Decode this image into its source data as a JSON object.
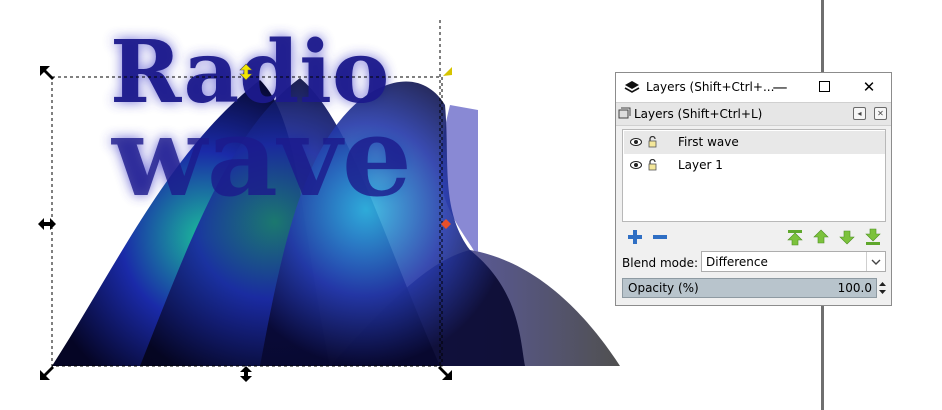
{
  "canvas": {
    "artwork_words": [
      "Radio",
      "wave"
    ]
  },
  "layers_window": {
    "title": "Layers (Shift+Ctrl+...",
    "minimize_glyph": "—",
    "close_glyph": "✕",
    "dock_title": "Layers (Shift+Ctrl+L)",
    "layers": [
      {
        "label": "First wave",
        "selected": true
      },
      {
        "label": "Layer 1",
        "selected": false
      }
    ],
    "blend_mode_label": "Blend mode:",
    "blend_mode_value": "Difference",
    "opacity_label": "Opacity (%)",
    "opacity_value": "100.0"
  },
  "colors": {
    "text_fill": "#1c1a8c",
    "arrow_green": "#7cc23c",
    "add_remove_blue": "#2f6fc4",
    "handle_red": "#e8502a"
  },
  "icons": [
    "layers-app-icon",
    "eye-icon",
    "lock-icon",
    "add-layer-icon",
    "remove-layer-icon",
    "raise-to-top-icon",
    "raise-icon",
    "lower-icon",
    "lower-to-bottom-icon",
    "dropdown-arrow-icon",
    "spin-arrows-icon"
  ]
}
